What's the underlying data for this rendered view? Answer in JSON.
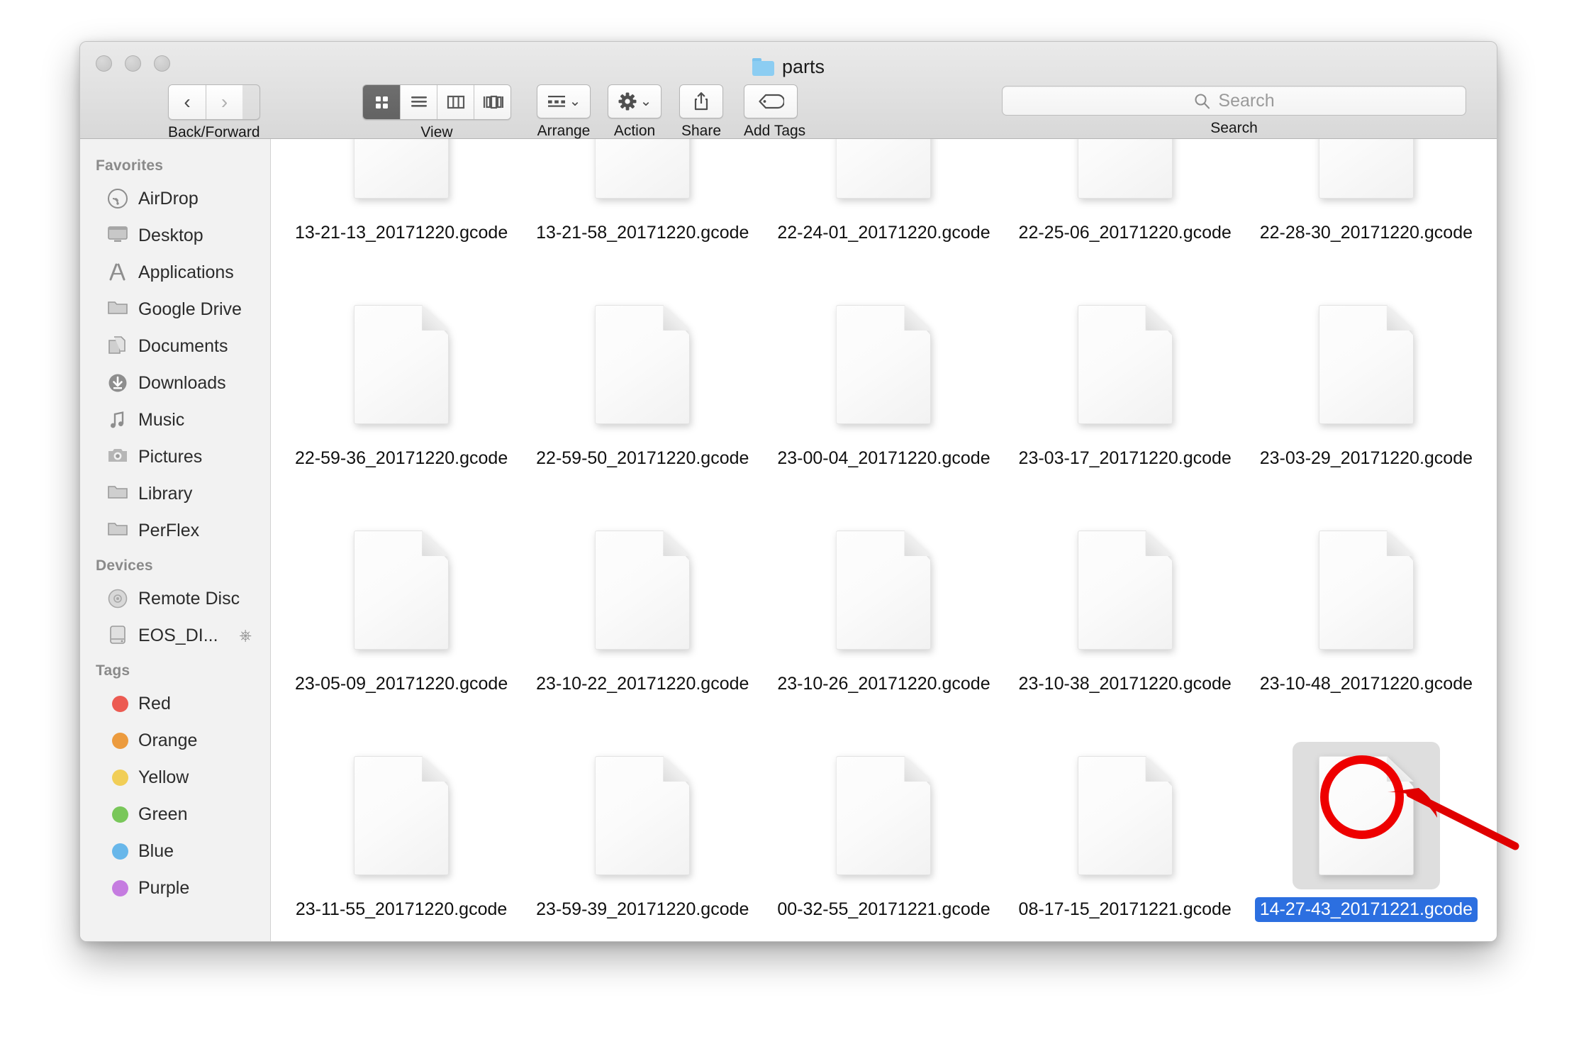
{
  "window": {
    "title": "parts",
    "title_icon": "folder-icon",
    "traffic_lights": [
      "close-button",
      "minimize-button",
      "zoom-button"
    ]
  },
  "toolbar": {
    "nav": {
      "label": "Back/Forward",
      "back_icon": "chevron-left-icon",
      "forward_icon": "chevron-right-icon"
    },
    "view": {
      "label": "View",
      "options": [
        {
          "name": "icon-view",
          "icon": "grid-icon",
          "active": true
        },
        {
          "name": "list-view",
          "icon": "list-icon",
          "active": false
        },
        {
          "name": "column-view",
          "icon": "columns-icon",
          "active": false
        },
        {
          "name": "gallery-view",
          "icon": "gallery-icon",
          "active": false
        }
      ]
    },
    "arrange": {
      "label": "Arrange",
      "icon": "arrange-grid-icon",
      "chevron": "chevron-down-icon"
    },
    "action": {
      "label": "Action",
      "icon": "gear-icon",
      "chevron": "chevron-down-icon"
    },
    "share": {
      "label": "Share",
      "icon": "share-icon"
    },
    "add_tags": {
      "label": "Add Tags",
      "icon": "tag-icon"
    },
    "search": {
      "label": "Search",
      "placeholder": "Search",
      "value": "",
      "icon": "search-icon"
    }
  },
  "sidebar": {
    "sections": [
      {
        "header": "Favorites",
        "items": [
          {
            "label": "AirDrop",
            "icon": "airdrop-icon"
          },
          {
            "label": "Desktop",
            "icon": "desktop-icon"
          },
          {
            "label": "Applications",
            "icon": "applications-icon"
          },
          {
            "label": "Google Drive",
            "icon": "folder-icon"
          },
          {
            "label": "Documents",
            "icon": "documents-icon"
          },
          {
            "label": "Downloads",
            "icon": "downloads-icon"
          },
          {
            "label": "Music",
            "icon": "music-icon"
          },
          {
            "label": "Pictures",
            "icon": "pictures-icon"
          },
          {
            "label": "Library",
            "icon": "folder-icon"
          },
          {
            "label": "PerFlex",
            "icon": "folder-icon"
          }
        ]
      },
      {
        "header": "Devices",
        "items": [
          {
            "label": "Remote Disc",
            "icon": "disc-icon"
          },
          {
            "label": "EOS_DI...",
            "icon": "drive-icon",
            "eject": "eject-icon"
          }
        ]
      },
      {
        "header": "Tags",
        "items": [
          {
            "label": "Red",
            "color": "#ec5b52"
          },
          {
            "label": "Orange",
            "color": "#ec9b3e"
          },
          {
            "label": "Yellow",
            "color": "#f1ce57"
          },
          {
            "label": "Green",
            "color": "#79c css"
          },
          {
            "label": "Blue",
            "color": "#68b7ea"
          },
          {
            "label": "Purple",
            "color": "#c57ce0"
          }
        ]
      }
    ]
  },
  "files": [
    {
      "name": "13-21-13_20171220.gcode",
      "selected": false
    },
    {
      "name": "13-21-58_20171220.gcode",
      "selected": false
    },
    {
      "name": "22-24-01_20171220.gcode",
      "selected": false
    },
    {
      "name": "22-25-06_20171220.gcode",
      "selected": false
    },
    {
      "name": "22-28-30_20171220.gcode",
      "selected": false
    },
    {
      "name": "22-59-36_20171220.gcode",
      "selected": false
    },
    {
      "name": "22-59-50_20171220.gcode",
      "selected": false
    },
    {
      "name": "23-00-04_20171220.gcode",
      "selected": false
    },
    {
      "name": "23-03-17_20171220.gcode",
      "selected": false
    },
    {
      "name": "23-03-29_20171220.gcode",
      "selected": false
    },
    {
      "name": "23-05-09_20171220.gcode",
      "selected": false
    },
    {
      "name": "23-10-22_20171220.gcode",
      "selected": false
    },
    {
      "name": "23-10-26_20171220.gcode",
      "selected": false
    },
    {
      "name": "23-10-38_20171220.gcode",
      "selected": false
    },
    {
      "name": "23-10-48_20171220.gcode",
      "selected": false
    },
    {
      "name": "23-11-55_20171220.gcode",
      "selected": false
    },
    {
      "name": "23-59-39_20171220.gcode",
      "selected": false
    },
    {
      "name": "00-32-55_20171221.gcode",
      "selected": false
    },
    {
      "name": "08-17-15_20171221.gcode",
      "selected": false
    },
    {
      "name": "14-27-43_20171221.gcode",
      "selected": true
    }
  ],
  "annotations": {
    "circle": {
      "name": "highlight-circle",
      "color": "#ee0000"
    },
    "arrow": {
      "name": "pointer-arrow",
      "color": "#e00000"
    }
  },
  "colors": {
    "selection_blue": "#2c6fe0",
    "annotation_red": "#ee0000",
    "folder_blue": "#8ccdf2"
  }
}
